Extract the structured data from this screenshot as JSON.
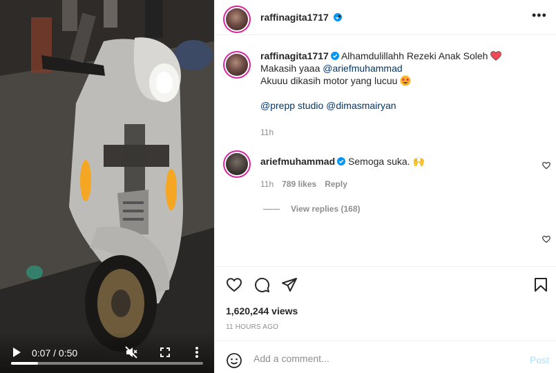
{
  "post": {
    "author": "raffinagita1717",
    "header_dot": "•",
    "more_label": "•••",
    "caption": {
      "author": "raffinagita1717",
      "line1_text": "Alhamdulillahh Rezeki Anak Soleh",
      "line2_prefix": "Makasih yaaa",
      "line2_mention": "@ariefmuhammad",
      "line3_text": "Akuuu dikasih motor yang lucuu",
      "line4_mention1": "@prepp studio",
      "line4_mention2": "@dimasmairyan",
      "time": "11h"
    },
    "comment": {
      "author": "ariefmuhammad",
      "text": "Semoga suka.",
      "emoji": "🙌",
      "time": "11h",
      "likes": "789 likes",
      "reply_label": "Reply",
      "view_replies": "View replies (168)"
    },
    "views": "1,620,244 views",
    "posted_ago": "11 HOURS AGO",
    "add_comment_placeholder": "Add a comment...",
    "post_button": "Post"
  },
  "video": {
    "time_display": "0:07 / 0:50",
    "progress_fraction": 0.14
  },
  "colors": {
    "verified_blue": "#0095f6",
    "link": "#00376b",
    "heart_red": "#ed4956",
    "post_disabled": "#b2dffc"
  },
  "icons": {
    "play": "play-icon",
    "mute": "muted-speaker-icon",
    "fullscreen": "fullscreen-icon",
    "video_more": "vertical-dots-icon",
    "like": "heart-outline-icon",
    "comment": "speech-bubble-icon",
    "share": "paper-plane-icon",
    "save": "bookmark-icon",
    "emoji": "smiley-icon"
  }
}
